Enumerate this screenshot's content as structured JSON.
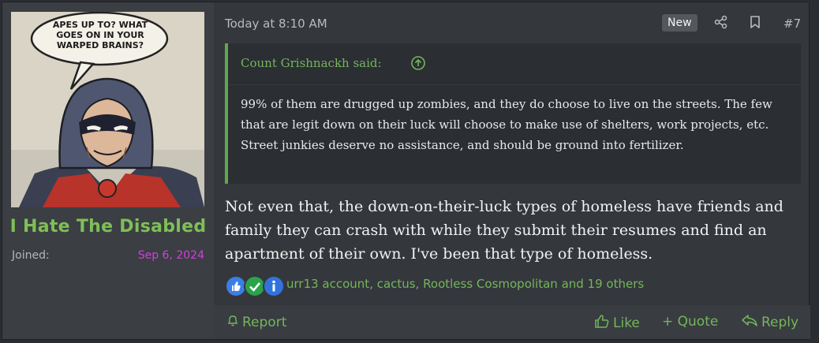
{
  "user": {
    "avatar_caption": "APES UP TO? WHAT GOES ON IN YOUR WARPED BRAINS?",
    "name": "I Hate The Disabled",
    "joined_label": "Joined:",
    "joined_value": "Sep 6, 2024"
  },
  "post": {
    "date": "Today at 8:10 AM",
    "badge": "New",
    "number": "#7",
    "quote": {
      "author": "Count Grishnackh said:",
      "text": "99% of them are drugged up zombies, and they do choose to live on the streets. The few that are legit down on their luck will choose to make use of shelters, work projects, etc. Street junkies deserve no assistance, and should be ground into fertilizer."
    },
    "body": "Not even that, the down-on-their-luck types of homeless have friends and family they can crash with while they submit their resumes and find an apartment of their own. I've been that type of homeless.",
    "reactions": {
      "icons": [
        "like-icon",
        "agree-icon",
        "informative-icon"
      ],
      "text": "urr13 account, cactus, Rootless Cosmopolitan and 19 others"
    },
    "footer": {
      "report": "Report",
      "like": "Like",
      "quote": "+ Quote",
      "reply": "Reply"
    }
  },
  "colors": {
    "username": "#7fbf57",
    "joined_date": "#d23ee0",
    "accent": "#74b65c"
  }
}
